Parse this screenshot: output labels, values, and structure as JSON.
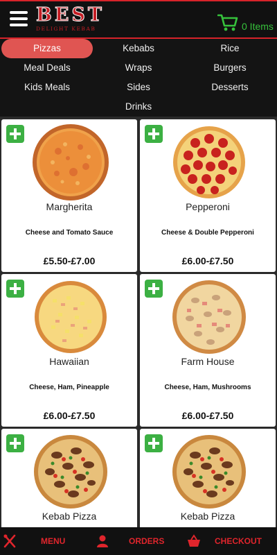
{
  "header": {
    "logo_main": "BEST",
    "logo_sub": "DELIGHT KEBAB",
    "cart_count": "0 Items"
  },
  "categories": [
    {
      "label": "Pizzas",
      "active": true
    },
    {
      "label": "Kebabs"
    },
    {
      "label": "Rice"
    },
    {
      "label": "Meal Deals"
    },
    {
      "label": "Wraps"
    },
    {
      "label": "Burgers"
    },
    {
      "label": "Kids Meals"
    },
    {
      "label": "Sides"
    },
    {
      "label": "Desserts"
    },
    {
      "label": "Drinks"
    }
  ],
  "products": [
    {
      "name": "Margherita",
      "desc": "Cheese and Tomato Sauce",
      "price": "£5.50-£7.00",
      "style": "margherita"
    },
    {
      "name": "Pepperoni",
      "desc": "Cheese & Double Pepperoni",
      "price": "£6.00-£7.50",
      "style": "pepperoni"
    },
    {
      "name": "Hawaiian",
      "desc": "Cheese, Ham, Pineapple",
      "price": "£6.00-£7.50",
      "style": "hawaiian"
    },
    {
      "name": "Farm House",
      "desc": "Cheese, Ham, Mushrooms",
      "price": "£6.00-£7.50",
      "style": "farmhouse"
    },
    {
      "name": "Kebab Pizza",
      "desc": "",
      "price": "",
      "style": "kebab"
    },
    {
      "name": "Kebab Pizza",
      "desc": "",
      "price": "",
      "style": "kebab"
    }
  ],
  "bottom_nav": {
    "menu_label": "MENU",
    "orders_label": "ORDERS",
    "checkout_label": "CHECKOUT"
  },
  "colors": {
    "accent_red": "#d8232a",
    "active_pill": "#e05552",
    "cart_green": "#36c23c",
    "add_green": "#3cb043"
  }
}
